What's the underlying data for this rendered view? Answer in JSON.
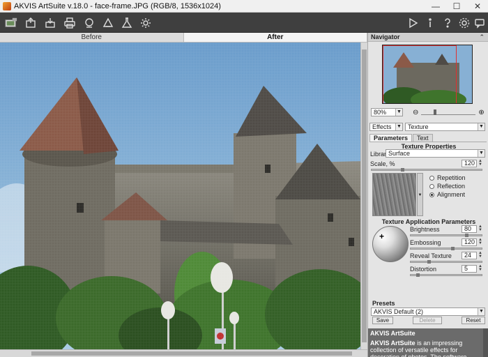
{
  "window": {
    "title": "AKVIS ArtSuite v.18.0 - face-frame.JPG (RGB/8, 1536x1024)"
  },
  "toolbar": {
    "left_icons": [
      "app-logo-icon",
      "open-file-icon",
      "save-file-icon",
      "print-icon",
      "batch-icon",
      "filter-icon",
      "flask-icon",
      "gear-cog-icon"
    ],
    "right_icons": [
      "play-icon",
      "info-icon",
      "help-icon",
      "settings-icon",
      "chat-icon"
    ]
  },
  "view_tabs": {
    "before": "Before",
    "after": "After"
  },
  "navigator": {
    "title": "Navigator",
    "zoom": "80%",
    "zoom_minus": "⊖",
    "zoom_plus": "⊕"
  },
  "effects": {
    "category": "Effects",
    "effect": "Texture"
  },
  "param_tabs": {
    "parameters": "Parameters",
    "text": "Text"
  },
  "texture_properties": {
    "title": "Texture Properties",
    "library_label": "Library",
    "library_value": "Surface",
    "scale_label": "Scale, %",
    "scale_value": "120",
    "options": [
      "Repetition",
      "Reflection",
      "Alignment"
    ],
    "selected_option": "Alignment"
  },
  "application_params": {
    "title": "Texture Application Parameters",
    "brightness_label": "Brightness",
    "brightness": "80",
    "embossing_label": "Embossing",
    "embossing": "120",
    "reveal_label": "Reveal Texture",
    "reveal": "24",
    "distortion_label": "Distortion",
    "distortion": "5"
  },
  "presets": {
    "title": "Presets",
    "selected": "AKVIS Default (2)",
    "save": "Save",
    "delete": "Delete",
    "reset": "Reset"
  },
  "help": {
    "title": "AKVIS ArtSuite",
    "brand": "AKVIS ArtSuite",
    "body": " is an impressing collection of versatile effects for decoration of photos. The software offers a lot of basic effects that"
  },
  "colors": {
    "toolbar_bg": "#3f3f3f",
    "panel_bg": "#e4e4e4",
    "sky": "#7aa8cf"
  }
}
